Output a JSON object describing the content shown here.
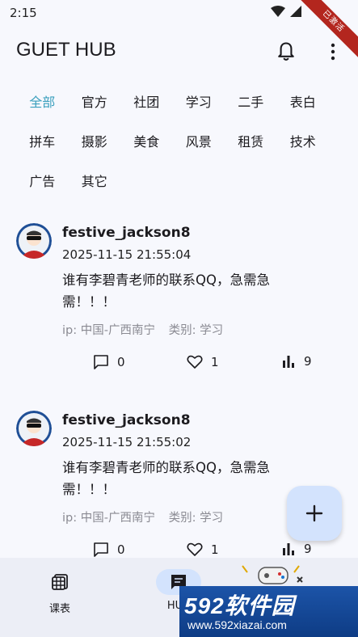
{
  "status": {
    "time": "2:15",
    "debug_banner": "已激活"
  },
  "app": {
    "title": "GUET HUB"
  },
  "icons": {
    "bell": "bell-icon",
    "more": "more-vert-icon",
    "add": "add-icon"
  },
  "colors": {
    "accent": "#3a9fbd",
    "fab_bg": "#d3e3fd",
    "nav_bg": "#eceef6"
  },
  "categories": [
    "全部",
    "官方",
    "社团",
    "学习",
    "二手",
    "表白",
    "拼车",
    "摄影",
    "美食",
    "风景",
    "租赁",
    "技术",
    "广告",
    "其它"
  ],
  "active_category": "全部",
  "posts": [
    {
      "username": "festive_jackson8",
      "time": "2025-11-15 21:55:04",
      "content": "谁有李碧青老师的联系QQ，急需急需！！！",
      "ip": "ip: 中国-广西南宁",
      "category": "类别: 学习",
      "comments": "0",
      "likes": "1",
      "views": "9"
    },
    {
      "username": "festive_jackson8",
      "time": "2025-11-15 21:55:02",
      "content": "谁有李碧青老师的联系QQ，急需急需！！！",
      "ip": "ip: 中国-广西南宁",
      "category": "类别: 学习",
      "comments": "0",
      "likes": "1",
      "views": "9"
    }
  ],
  "nav": [
    {
      "label": "课表",
      "icon": "calendar-grid-icon"
    },
    {
      "label": "HUB",
      "icon": "chat-icon"
    },
    {
      "label": "",
      "icon": "gamepad-icon"
    }
  ],
  "watermark": {
    "brand": "592软件园",
    "url": "www.592xiazai.com"
  }
}
